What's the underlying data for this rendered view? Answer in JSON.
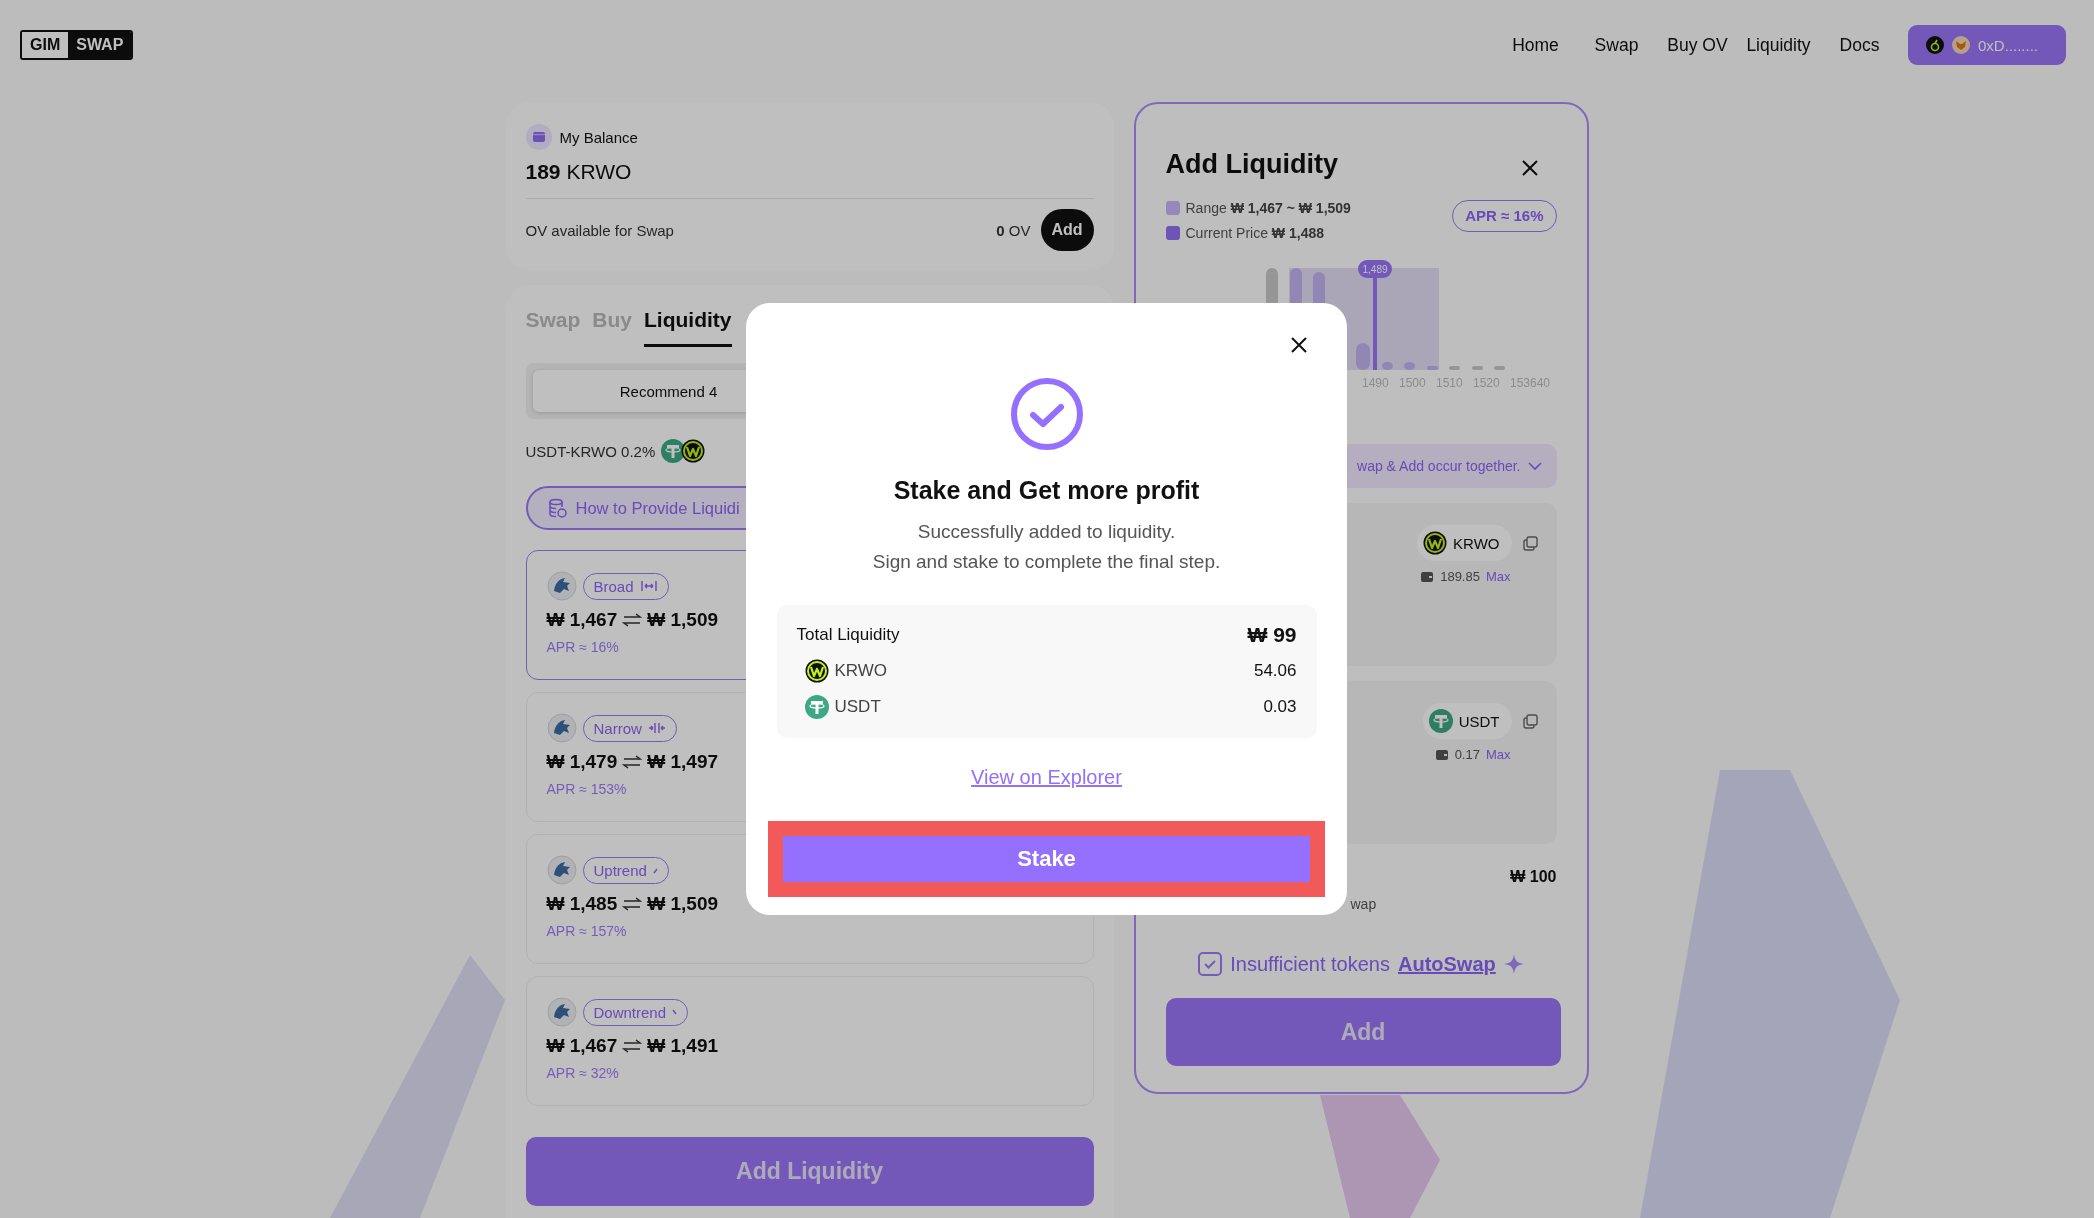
{
  "header": {
    "logo": [
      "GIM",
      "SWAP"
    ],
    "nav": [
      {
        "label": "Home"
      },
      {
        "label": "Swap"
      },
      {
        "label": "Buy OV"
      },
      {
        "label": "Liquidity"
      },
      {
        "label": "Docs"
      }
    ],
    "wallet": {
      "address": "0xD........"
    }
  },
  "balance": {
    "title": "My Balance",
    "amount": "189",
    "unit": "KRWO",
    "ov_label": "OV available for Swap",
    "ov_amount": "0",
    "ov_unit": "OV",
    "add_button": "Add"
  },
  "tabs": [
    {
      "label": "Swap",
      "selected": false
    },
    {
      "label": "Buy",
      "selected": false
    },
    {
      "label": "Liquidity",
      "selected": true
    }
  ],
  "segments": [
    {
      "label": "Recommend 4",
      "selected": true
    }
  ],
  "pool": {
    "label": "USDT-KRWO 0.2%"
  },
  "guide_button": "How to Provide Liquidi",
  "strategies": [
    {
      "tag": "Broad",
      "kind": "broad",
      "min": "₩ 1,467",
      "max": "₩ 1,509",
      "apr": "APR ≈ 16%",
      "selected": true
    },
    {
      "tag": "Narrow",
      "kind": "narrow",
      "min": "₩ 1,479",
      "max": "₩ 1,497",
      "apr": "APR ≈ 153%",
      "selected": false
    },
    {
      "tag": "Uptrend",
      "kind": "uptrend",
      "min": "₩ 1,485",
      "max": "₩ 1,509",
      "apr": "APR ≈ 157%",
      "selected": false
    },
    {
      "tag": "Downtrend",
      "kind": "downtrend",
      "min": "₩ 1,467",
      "max": "₩ 1,491",
      "apr": "APR ≈ 32%",
      "selected": false
    }
  ],
  "add_liquidity_button": "Add Liquidity",
  "panel": {
    "title": "Add Liquidity",
    "legend": [
      {
        "label": "Range",
        "value": "₩ 1,467 ~ ₩ 1,509",
        "kind": "range"
      },
      {
        "label": "Current Price",
        "value": "₩ 1,488",
        "kind": "current"
      }
    ],
    "apr_badge": "APR ≈ 16%",
    "chart": {
      "marker": "1,489",
      "x_labels": [
        "1490",
        "1500",
        "1510",
        "1520",
        "153640"
      ]
    },
    "notice": "wap & Add occur together.",
    "tokens": [
      {
        "symbol": "KRWO",
        "kind": "krwo",
        "balance": "189.85",
        "max": "Max"
      },
      {
        "symbol": "USDT",
        "kind": "usdt",
        "balance": "0.17",
        "max": "Max"
      }
    ],
    "total": "₩ 100",
    "partial_note": "wap",
    "autoswap": {
      "checked": true,
      "text": "Insufficient tokens",
      "link": "AutoSwap"
    },
    "add_button": "Add"
  },
  "modal": {
    "title": "Stake and Get more profit",
    "message": [
      "Successfully added to liquidity.",
      "Sign and stake to complete the final step."
    ],
    "summary": {
      "label": "Total Liquidity",
      "total": "₩ 99",
      "rows": [
        {
          "symbol": "KRWO",
          "kind": "krwo",
          "amount": "54.06"
        },
        {
          "symbol": "USDT",
          "kind": "usdt",
          "amount": "0.03"
        }
      ]
    },
    "link": "View on Explorer",
    "button": "Stake"
  }
}
